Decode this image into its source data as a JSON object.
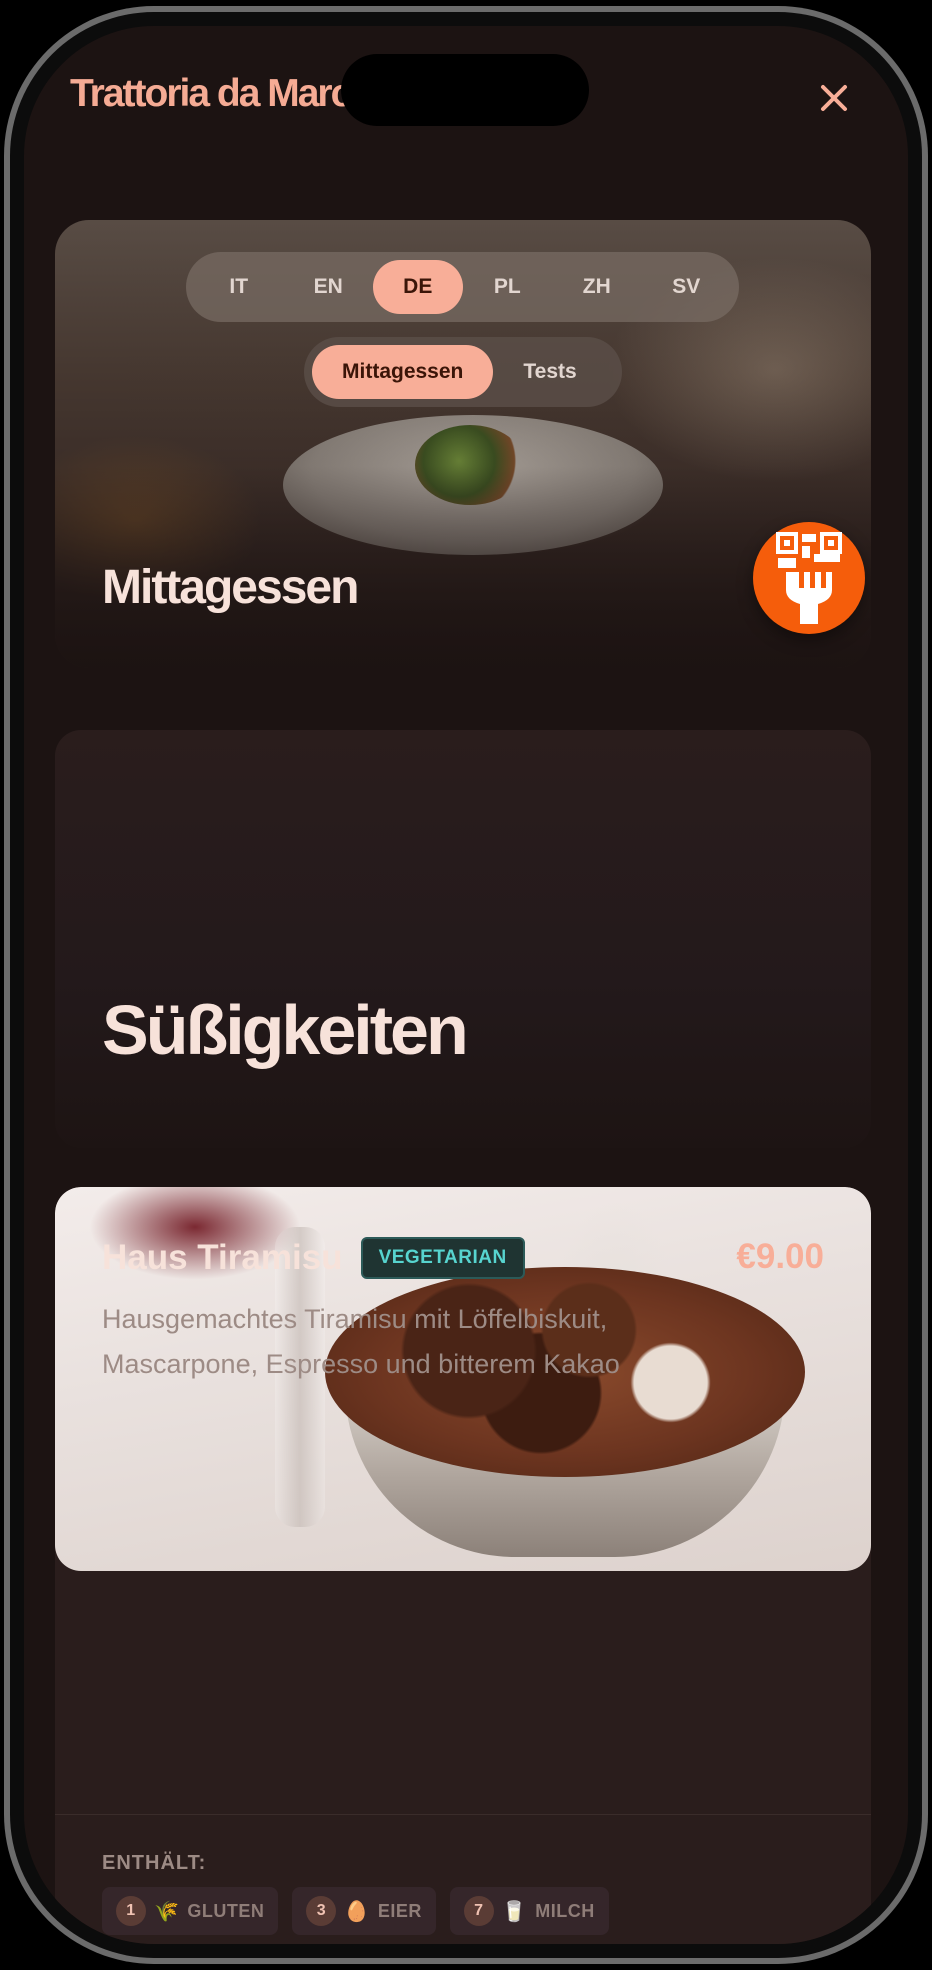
{
  "app": {
    "title": "Trattoria da Marco"
  },
  "languages": [
    {
      "code": "IT",
      "active": false
    },
    {
      "code": "EN",
      "active": false
    },
    {
      "code": "DE",
      "active": true
    },
    {
      "code": "PL",
      "active": false
    },
    {
      "code": "ZH",
      "active": false
    },
    {
      "code": "SV",
      "active": false
    }
  ],
  "menus": [
    {
      "label": "Mittagessen",
      "active": true
    },
    {
      "label": "Tests",
      "active": false
    }
  ],
  "hero": {
    "title": "Mittagessen"
  },
  "category": {
    "title": "Süßigkeiten"
  },
  "dish": {
    "name": "Haus Tiramisu",
    "badge": "VEGETARIAN",
    "price": "€9.00",
    "description": "Hausgemachtes Tiramisu mit Löffelbiskuit, Mascarpone, Espresso und bitterem Kakao",
    "contains_label": "ENTHÄLT:",
    "allergens": [
      {
        "number": "1",
        "icon": "wheat-icon",
        "glyph": "🌾",
        "label": "GLUTEN"
      },
      {
        "number": "3",
        "icon": "egg-icon",
        "glyph": "🥚",
        "label": "EIER"
      },
      {
        "number": "7",
        "icon": "milk-icon",
        "glyph": "🥛",
        "label": "MILCH"
      }
    ]
  },
  "colors": {
    "accent": "#f8ae98",
    "background": "#1c1312",
    "qr_badge": "#f55d0b",
    "vegetarian": "#57d4cf"
  }
}
